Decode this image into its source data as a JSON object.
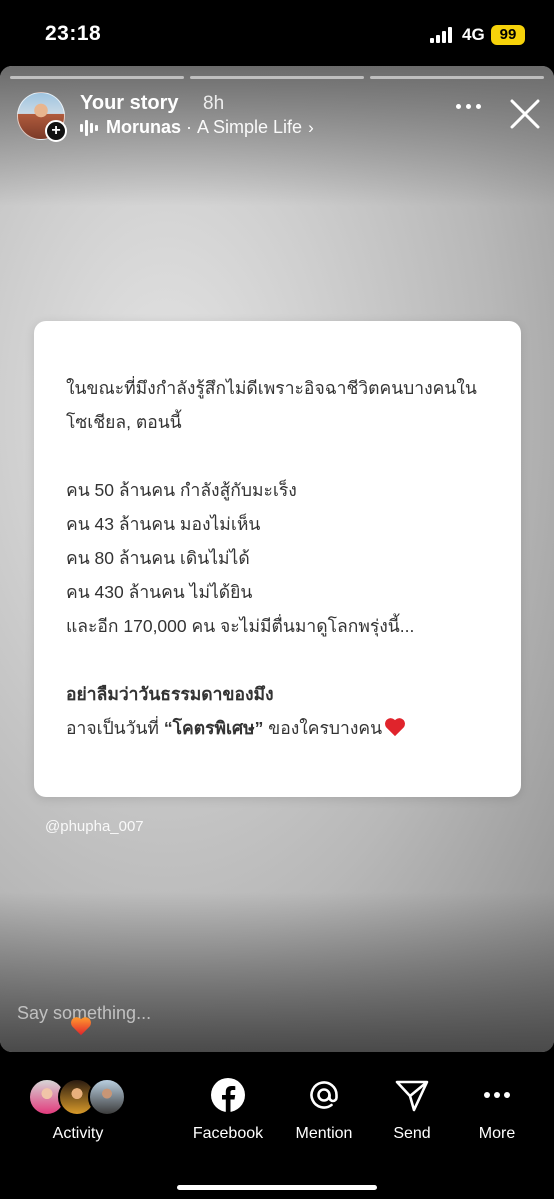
{
  "status_bar": {
    "time": "23:18",
    "network": "4G",
    "battery": "99"
  },
  "story": {
    "username": "Your story",
    "age": "8h",
    "music": {
      "artist": "Morunas",
      "separator": "·",
      "song": "A Simple Life",
      "chevron": "›"
    },
    "note_lines": [
      "ในขณะที่มึงกำลังรู้สึกไม่ดีเพราะอิจฉาชีวิตคนบางคนใน",
      "โซเชียล, ตอนนี้",
      "คน 50 ล้านคน กำลังสู้กับมะเร็ง",
      "คน 43 ล้านคน มองไม่เห็น",
      "คน 80 ล้านคน เดินไม่ได้",
      "คน 430 ล้านคน ไม่ได้ยิน",
      "และอีก 170,000 คน จะไม่มีตื่นมาดูโลกพรุ่งนี้...",
      "อย่าลืมว่าวันธรรมดาของมึง",
      "อาจเป็นวันที่ ",
      "“โคตรพิเศษ”",
      " ของใครบางคน"
    ],
    "tag": "@phupha_007",
    "reply_placeholder": "Say something..."
  },
  "bottom_bar": {
    "activity_label": "Activity",
    "facebook_label": "Facebook",
    "mention_label": "Mention",
    "send_label": "Send",
    "more_label": "More"
  },
  "colors": {
    "battery": "#f6d20a",
    "heart": "#e0242c",
    "facebook_icon": "#ffffff"
  },
  "icons": [
    "signal-icon",
    "battery-icon",
    "audio-bars-icon",
    "more-dots-icon",
    "close-icon",
    "heart-icon",
    "facebook-icon",
    "mention-icon",
    "send-icon",
    "more-icon"
  ]
}
